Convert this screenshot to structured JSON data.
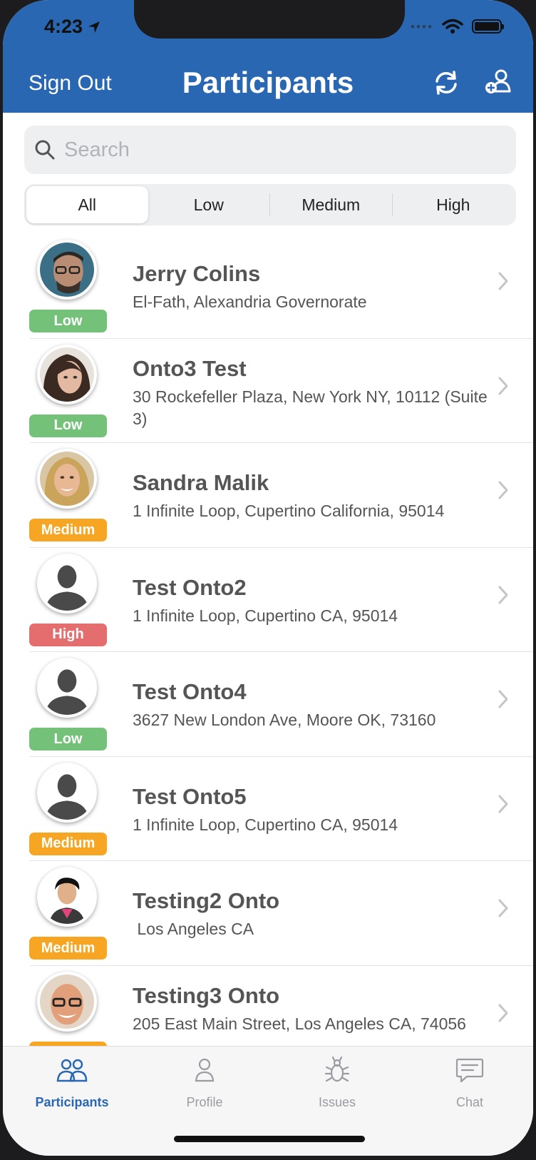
{
  "status": {
    "time": "4:23"
  },
  "header": {
    "sign_out": "Sign Out",
    "title": "Participants",
    "refresh_icon": "refresh-icon",
    "add_user_icon": "add-user-icon"
  },
  "search": {
    "placeholder": "Search",
    "value": ""
  },
  "segments": [
    {
      "label": "All",
      "selected": true
    },
    {
      "label": "Low",
      "selected": false
    },
    {
      "label": "Medium",
      "selected": false
    },
    {
      "label": "High",
      "selected": false
    }
  ],
  "colors": {
    "header": "#2a67b2",
    "low": "#74c27a",
    "medium": "#f6a623",
    "high": "#e46d6d"
  },
  "participants": [
    {
      "name": "Jerry Colins",
      "address": "El-Fath, Alexandria Governorate",
      "priority": "Low",
      "avatar": "photo-man-glasses"
    },
    {
      "name": "Onto3 Test",
      "address": "30 Rockefeller Plaza, New York NY, 10112 (Suite 3)",
      "priority": "Low",
      "avatar": "photo-woman-dark-hair"
    },
    {
      "name": "Sandra Malik",
      "address": "1 Infinite Loop, Cupertino California, 95014",
      "priority": "Medium",
      "avatar": "photo-woman-blonde"
    },
    {
      "name": "Test Onto2",
      "address": "1 Infinite Loop, Cupertino CA, 95014",
      "priority": "High",
      "avatar": "placeholder-person-icon"
    },
    {
      "name": "Test Onto4",
      "address": "3627 New London Ave, Moore OK, 73160",
      "priority": "Low",
      "avatar": "placeholder-person-icon"
    },
    {
      "name": "Test Onto5",
      "address": "1 Infinite Loop, Cupertino CA, 95014",
      "priority": "Medium",
      "avatar": "placeholder-person-icon"
    },
    {
      "name": "Testing2 Onto",
      "address": " Los Angeles CA",
      "priority": "Medium",
      "avatar": "photo-man-pink-shirt"
    },
    {
      "name": "Testing3 Onto",
      "address": "205 East Main Street, Los Angeles CA, 74056",
      "priority": "",
      "avatar": "photo-man-smiling-glasses"
    }
  ],
  "tabs": [
    {
      "label": "Participants",
      "icon": "participants-icon",
      "active": true
    },
    {
      "label": "Profile",
      "icon": "profile-icon",
      "active": false
    },
    {
      "label": "Issues",
      "icon": "bug-icon",
      "active": false
    },
    {
      "label": "Chat",
      "icon": "chat-icon",
      "active": false
    }
  ]
}
